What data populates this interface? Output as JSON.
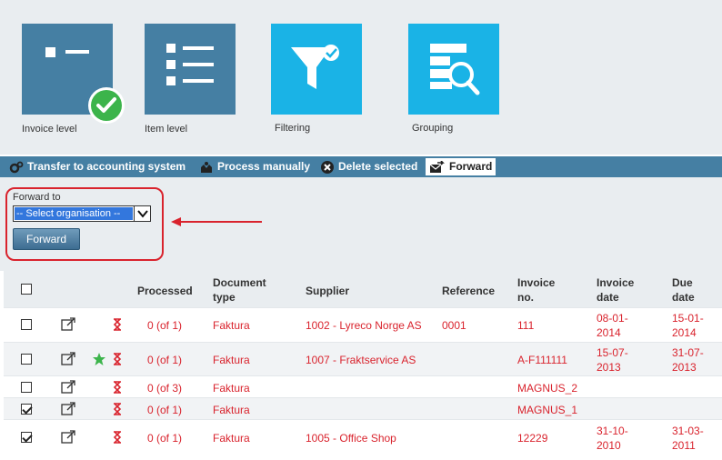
{
  "tiles": [
    {
      "label": "Invoice level",
      "icon": "invoice-level-icon",
      "color": "#457fa3",
      "selected": true
    },
    {
      "label": "Item level",
      "icon": "item-level-icon",
      "color": "#457fa3"
    },
    {
      "label": "Filtering",
      "icon": "filter-icon",
      "color": "#1ab3e6"
    },
    {
      "label": "Grouping",
      "icon": "grouping-icon",
      "color": "#1ab3e6"
    }
  ],
  "toolbar": {
    "transfer": "Transfer to accounting system",
    "manual": "Process manually",
    "delete": "Delete selected",
    "forward": "Forward"
  },
  "forward_panel": {
    "label": "Forward to",
    "select_value": "-- Select organisation --",
    "button": "Forward"
  },
  "table": {
    "headers": {
      "processed": "Processed",
      "doc_type_1": "Document",
      "doc_type_2": "type",
      "supplier": "Supplier",
      "reference": "Reference",
      "invoice_no_1": "Invoice",
      "invoice_no_2": "no.",
      "invoice_date_1": "Invoice",
      "invoice_date_2": "date",
      "due_date_1": "Due",
      "due_date_2": "date"
    },
    "rows": [
      {
        "checked": false,
        "starred": false,
        "processed": "0 (of 1)",
        "doc_type": "Faktura",
        "supplier": "1002 - Lyreco Norge AS",
        "reference": "0001",
        "invoice_no": "111",
        "invoice_date_1": "08-01-",
        "invoice_date_2": "2014",
        "due_date_1": "15-01-",
        "due_date_2": "2014"
      },
      {
        "checked": false,
        "starred": true,
        "processed": "0 (of 1)",
        "doc_type": "Faktura",
        "supplier": "1007 - Fraktservice AS",
        "reference": "",
        "invoice_no": "A-F111111",
        "invoice_date_1": "15-07-",
        "invoice_date_2": "2013",
        "due_date_1": "31-07-",
        "due_date_2": "2013"
      },
      {
        "checked": false,
        "starred": false,
        "processed": "0 (of 3)",
        "doc_type": "Faktura",
        "supplier": "",
        "reference": "",
        "invoice_no": "MAGNUS_2",
        "invoice_date_1": "",
        "invoice_date_2": "",
        "due_date_1": "",
        "due_date_2": ""
      },
      {
        "checked": true,
        "starred": false,
        "processed": "0 (of 1)",
        "doc_type": "Faktura",
        "supplier": "",
        "reference": "",
        "invoice_no": "MAGNUS_1",
        "invoice_date_1": "",
        "invoice_date_2": "",
        "due_date_1": "",
        "due_date_2": ""
      },
      {
        "checked": true,
        "starred": false,
        "processed": "0 (of 1)",
        "doc_type": "Faktura",
        "supplier": "1005 - Office Shop",
        "reference": "",
        "invoice_no": "12229",
        "invoice_date_1": "31-10-",
        "invoice_date_2": "2010",
        "due_date_1": "31-03-",
        "due_date_2": "2011"
      }
    ]
  },
  "colors": {
    "accent": "#457fa3",
    "tile_cyan": "#1ab3e6",
    "alert_red": "#d9232d",
    "check_green": "#3cb44b"
  }
}
